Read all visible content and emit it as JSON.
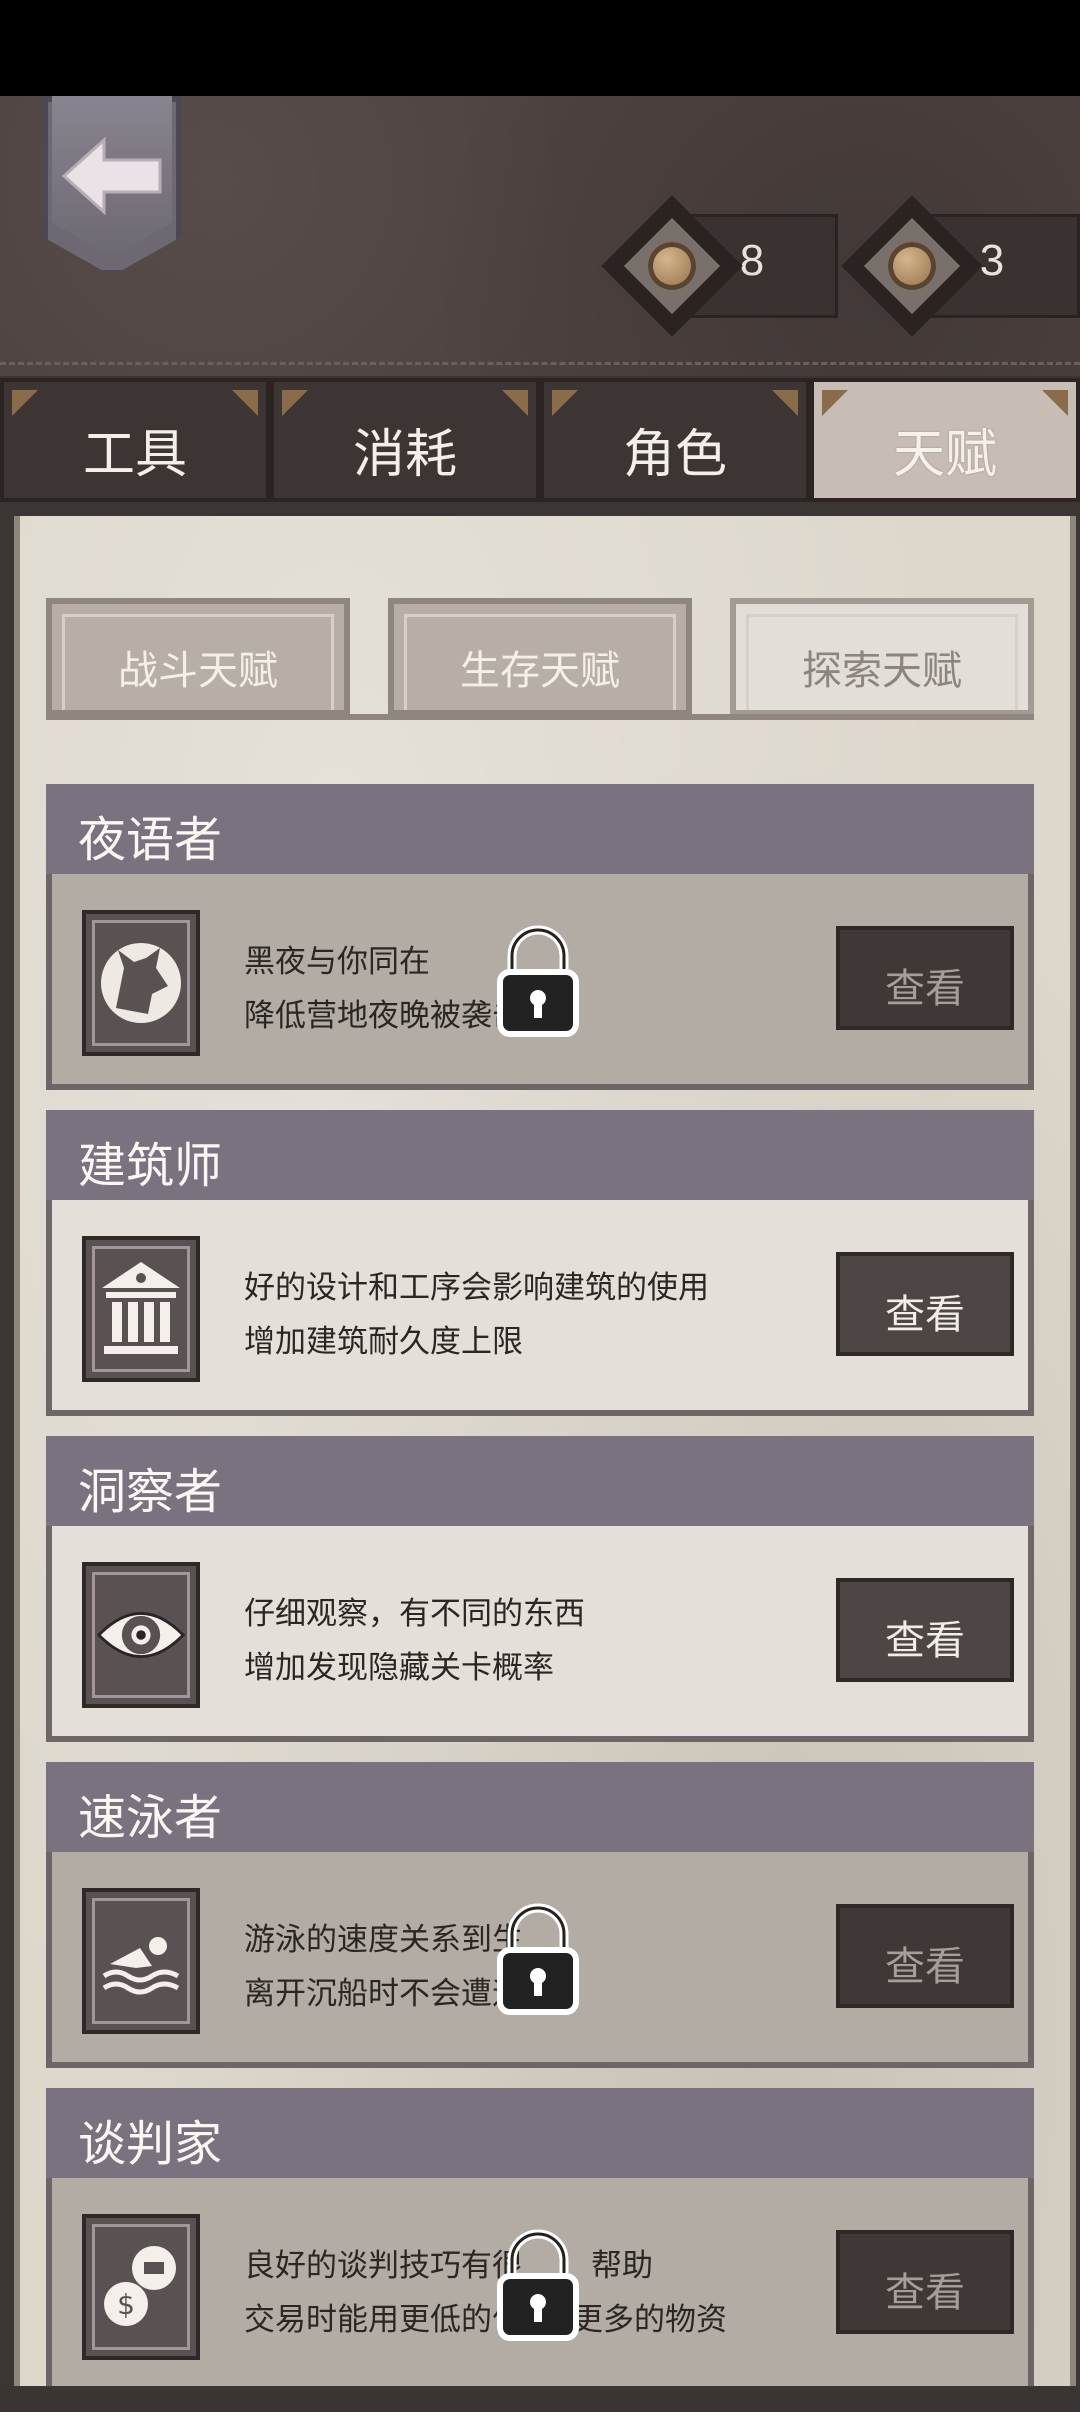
{
  "currencies": [
    {
      "icon": "coin-icon",
      "value": "8"
    },
    {
      "icon": "coin-icon",
      "value": "3"
    }
  ],
  "tabs": [
    {
      "label": "工具",
      "active": false
    },
    {
      "label": "消耗",
      "active": false
    },
    {
      "label": "角色",
      "active": false
    },
    {
      "label": "天赋",
      "active": true
    }
  ],
  "subtabs": [
    {
      "label": "战斗天赋",
      "active": false
    },
    {
      "label": "生存天赋",
      "active": false
    },
    {
      "label": "探索天赋",
      "active": true
    }
  ],
  "talents": [
    {
      "title": "夜语者",
      "line1": "黑夜与你同在",
      "line2": "降低营地夜晚被袭击",
      "button": "查看",
      "icon": "wolf-icon",
      "locked": true
    },
    {
      "title": "建筑师",
      "line1": "好的设计和工序会影响建筑的使用",
      "line2": "增加建筑耐久度上限",
      "button": "查看",
      "icon": "building-icon",
      "locked": false
    },
    {
      "title": "洞察者",
      "line1": "仔细观察，有不同的东西",
      "line2": "增加发现隐藏关卡概率",
      "button": "查看",
      "icon": "eye-icon",
      "locked": false
    },
    {
      "title": "速泳者",
      "line1": "游泳的速度关系到生",
      "line2": "离开沉船时不会遭遇",
      "button": "查看",
      "icon": "swimmer-icon",
      "locked": true
    },
    {
      "title": "谈判家",
      "line1": "良好的谈判技巧有很",
      "line2": "交易时能用更低的价",
      "line2b": "取更多的物资",
      "line1b": "帮助",
      "button": "查看",
      "icon": "trade-icon",
      "locked": true
    }
  ],
  "colors": {
    "leather": "#4d4341",
    "parchment": "#ddd7cc",
    "title_bar": "#7b7280",
    "button": "#4e4644"
  }
}
